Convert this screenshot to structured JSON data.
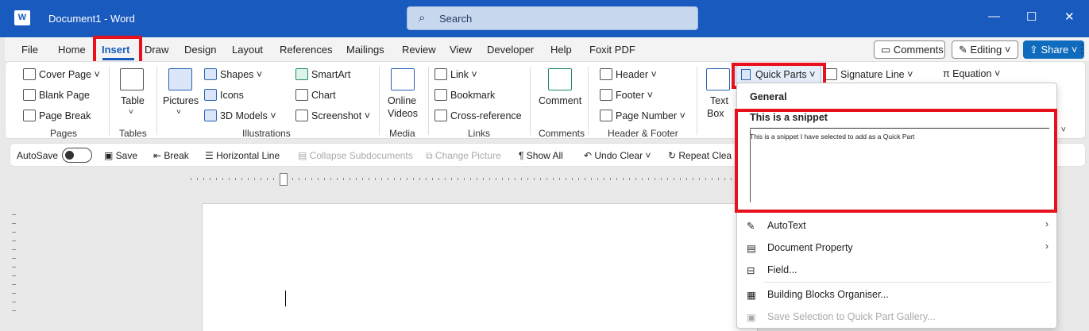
{
  "titlebar": {
    "app_letter": "W",
    "doc_title": "Document1  -  Word",
    "search_placeholder": "Search",
    "minimize": "—",
    "maximize": "☐",
    "close": "✕"
  },
  "tabs": [
    "File",
    "Home",
    "Insert",
    "Draw",
    "Design",
    "Layout",
    "References",
    "Mailings",
    "Review",
    "View",
    "Developer",
    "Help",
    "Foxit PDF"
  ],
  "active_tab": "Insert",
  "topbar": {
    "comments": "Comments",
    "editing": "Editing",
    "share": "Share"
  },
  "ribbon": {
    "pages": {
      "label": "Pages",
      "items": [
        "Cover Page",
        "Blank Page",
        "Page Break"
      ]
    },
    "tables": {
      "label": "Tables",
      "table": "Table"
    },
    "illustrations": {
      "label": "Illustrations",
      "pictures": "Pictures",
      "shapes": "Shapes",
      "icons": "Icons",
      "models": "3D Models",
      "smartart": "SmartArt",
      "chart": "Chart",
      "screenshot": "Screenshot"
    },
    "media": {
      "label": "Media",
      "online_videos_1": "Online",
      "online_videos_2": "Videos"
    },
    "links": {
      "label": "Links",
      "link": "Link",
      "bookmark": "Bookmark",
      "crossref": "Cross-reference"
    },
    "comments": {
      "label": "Comments",
      "comment": "Comment"
    },
    "header_footer": {
      "label": "Header & Footer",
      "header": "Header",
      "footer": "Footer",
      "page_number": "Page Number"
    },
    "text": {
      "text_box_1": "Text",
      "text_box_2": "Box",
      "quick_parts": "Quick Parts",
      "signature_line": "Signature Line",
      "equation": "Equation"
    }
  },
  "qat": {
    "autosave": "AutoSave",
    "toggle_state": "Off",
    "save": "Save",
    "break": "Break",
    "horizontal_line": "Horizontal Line",
    "collapse": "Collapse Subdocuments",
    "change_picture": "Change Picture",
    "show_all": "Show All",
    "undo_clear": "Undo Clear",
    "repeat_clear": "Repeat Clea"
  },
  "dropdown": {
    "general": "General",
    "snippet_title": "This is a snippet",
    "snippet_body": "This is a snippet I have selected to add as a Quick Part",
    "items": [
      {
        "label": "AutoText",
        "submenu": true,
        "disabled": false
      },
      {
        "label": "Document Property",
        "submenu": true,
        "disabled": false
      },
      {
        "label": "Field...",
        "submenu": false,
        "disabled": false
      },
      {
        "label": "Building Blocks Organiser...",
        "submenu": false,
        "disabled": false
      },
      {
        "label": "Save Selection to Quick Part Gallery...",
        "submenu": false,
        "disabled": true
      }
    ]
  },
  "colors": {
    "titlebar": "#185abd",
    "accent": "#185abd",
    "highlight_box": "#e8101d",
    "share_button": "#0f6cbd"
  }
}
